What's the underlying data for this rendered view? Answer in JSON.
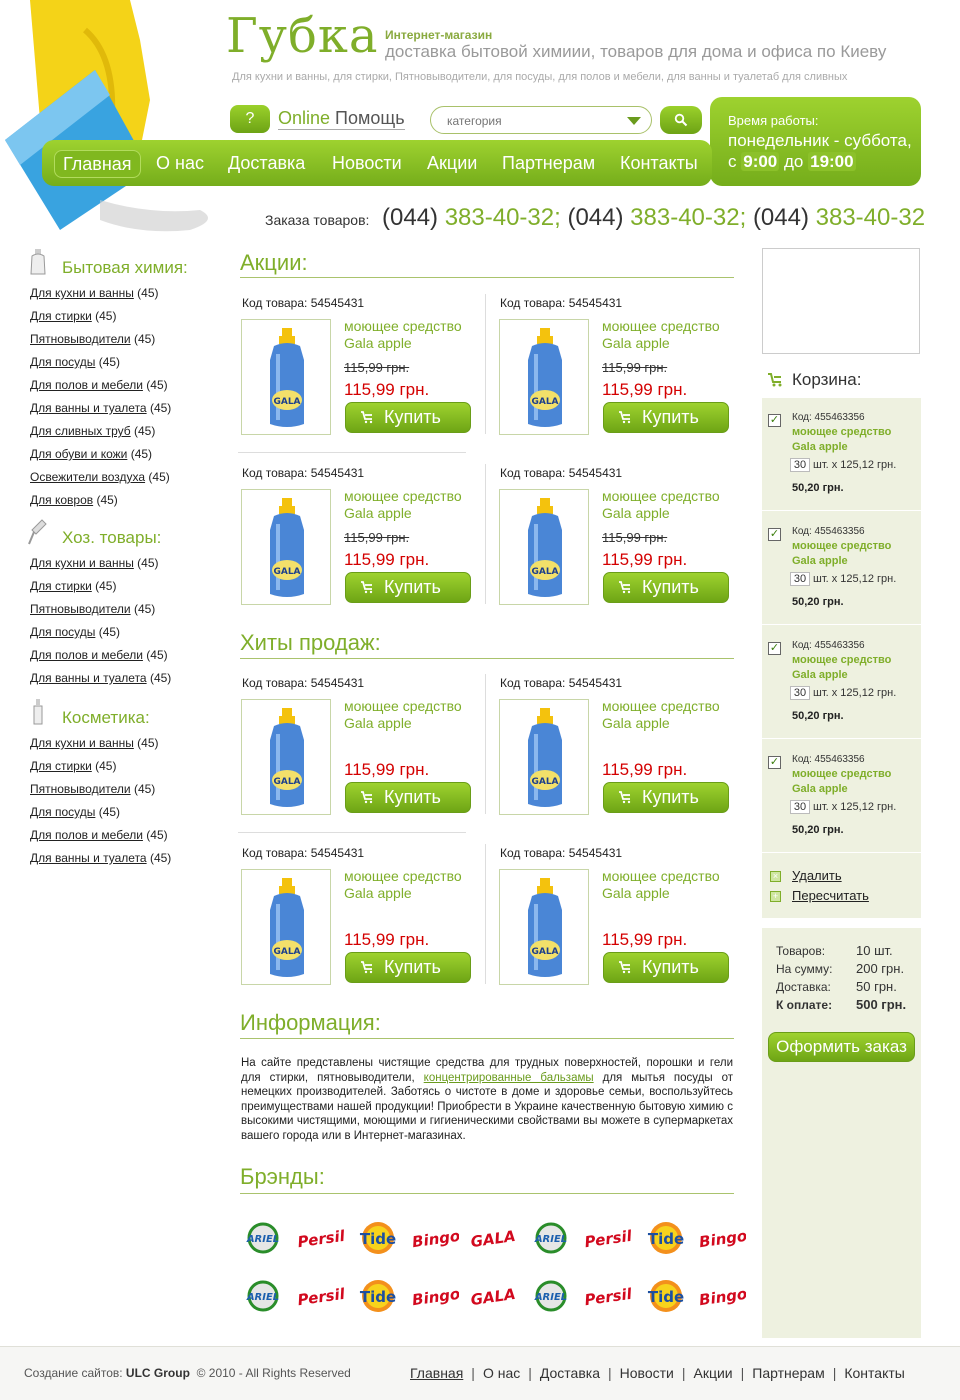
{
  "header": {
    "logo": "Губка",
    "tagline_small": "Интернет-магазин",
    "tagline_big": "доставка бытовой химиии, товаров для дома и офиса по Киеву",
    "categories_line": "Для кухни и ванны, для стирки, Пятновыводители, для посуды, для полов и мебели, для ванны и туалетаб  для сливных",
    "help_button": "?",
    "online_help_1": "Online",
    "online_help_2": "Помощь",
    "search_placeholder": "категория",
    "hours_title": "Время работы:",
    "hours_days": "понедельник - суббота,",
    "hours_from_pre": "с",
    "hours_from": "9:00",
    "hours_to_pre": "до",
    "hours_to": "19:00",
    "nav": [
      "Главная",
      "О нас",
      "Доставка",
      "Новости",
      "Акции",
      "Партнерам",
      "Контакты"
    ],
    "phone_label": "Заказа товаров:",
    "phone_codes": [
      "(044)",
      "(044)",
      "(044)"
    ],
    "phone_numbers": [
      "383-40-32;",
      "383-40-32;",
      "383-40-32"
    ]
  },
  "sidebar": {
    "sections": [
      {
        "title": "Бытовая химия:",
        "items": [
          [
            "Для кухни и ванны",
            "(45)"
          ],
          [
            "Для стирки",
            "(45)"
          ],
          [
            "Пятновыводители",
            "(45)"
          ],
          [
            "Для посуды",
            "(45)"
          ],
          [
            "Для полов и мебели",
            "(45)"
          ],
          [
            "Для ванны и туалета",
            "(45)"
          ],
          [
            "Для сливных труб",
            "(45)"
          ],
          [
            "Для обуви и кожи",
            "(45)"
          ],
          [
            "Освежители воздуха",
            "(45)"
          ],
          [
            "Для ковров",
            "(45)"
          ]
        ]
      },
      {
        "title": "Хоз. товары:",
        "items": [
          [
            "Для кухни и ванны",
            "(45)"
          ],
          [
            "Для стирки",
            "(45)"
          ],
          [
            "Пятновыводители",
            "(45)"
          ],
          [
            "Для посуды",
            "(45)"
          ],
          [
            "Для полов и мебели",
            "(45)"
          ],
          [
            "Для ванны и туалета",
            "(45)"
          ]
        ]
      },
      {
        "title": "Косметика:",
        "items": [
          [
            "Для кухни и ванны",
            "(45)"
          ],
          [
            "Для стирки",
            "(45)"
          ],
          [
            "Пятновыводители",
            "(45)"
          ],
          [
            "Для посуды",
            "(45)"
          ],
          [
            "Для полов и мебели",
            "(45)"
          ],
          [
            "Для ванны и туалета",
            "(45)"
          ]
        ]
      }
    ]
  },
  "main": {
    "promo_title": "Акции:",
    "hits_title": "Хиты продаж:",
    "info_title": "Информация:",
    "brands_title": "Брэнды:",
    "product": {
      "code_label": "Код товара: 54545431",
      "name_1": "моющее средство",
      "name_2": "Gala apple",
      "old_price": "115,99 грн.",
      "price": "115,99 грн.",
      "buy": "Купить"
    },
    "info_text_1": "На сайте представлены чистящие средства для трудных поверхностей, порошки и гели для стирки, пятновыводители, ",
    "info_link": "концентрированные бальзамы",
    "info_text_2": " для мытья посуды от немецких производителей. Заботясь о чистоте  в доме и здоровье семьи, воспользуйтесь преимуществами нашей продукции! Приобрести  в Украине качественную  бытовую химию с высокими чистящими, моющими и гигиеническими свойствами вы можете в супермаркетах вашего города или в Интернет-магазинах.",
    "brands": [
      "ARIEL",
      "Persil",
      "Tide",
      "Bingo",
      "GALA",
      "ARIEL",
      "Persil",
      "Tide",
      "Bingo"
    ]
  },
  "cart": {
    "title": "Корзина:",
    "item": {
      "code": "Код: 455463356",
      "name_1": "моющее средство",
      "name_2": "Gala apple",
      "qty": "30",
      "unit": "шт.  x  125,12 грн.",
      "sum": "50,20 грн."
    },
    "delete": "Удалить",
    "recalc": "Пересчитать",
    "totals": [
      [
        "Товаров:",
        "10 шт."
      ],
      [
        "На сумму:",
        "200 грн."
      ],
      [
        "Доставка:",
        "50 грн."
      ],
      [
        "К оплате:",
        "500 грн."
      ]
    ],
    "order": "Оформить заказ"
  },
  "footer": {
    "made_by_label": "Создание сайтов:",
    "made_by": "ULC Group",
    "copyright": "© 2010 - All Rights Reserved",
    "nav": [
      "Главная",
      "О нас",
      "Доставка",
      "Новости",
      "Акции",
      "Партнерам",
      "Контакты"
    ]
  },
  "colors": {
    "accent": "#7fae2a",
    "price": "#d40000",
    "cart_bg": "#eef1e0"
  }
}
